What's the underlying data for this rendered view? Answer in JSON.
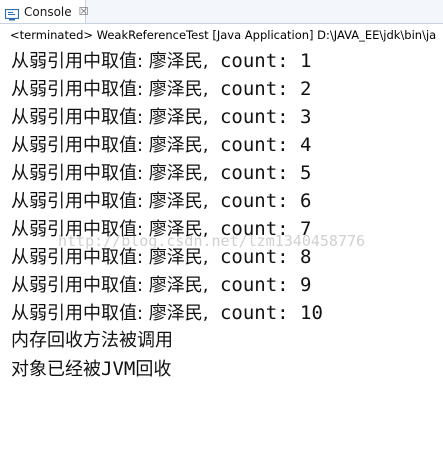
{
  "tab": {
    "label": "Console",
    "close_glyph": "☒",
    "icon": "console-monitor-icon"
  },
  "status_line": "<terminated> WeakReferenceTest [Java Application] D:\\JAVA_EE\\jdk\\bin\\ja",
  "output": {
    "lines": [
      {
        "prefix": "从弱引用中取值: 廖泽民,",
        "suffix": " count: 1"
      },
      {
        "prefix": "从弱引用中取值: 廖泽民,",
        "suffix": " count: 2"
      },
      {
        "prefix": "从弱引用中取值: 廖泽民,",
        "suffix": " count: 3"
      },
      {
        "prefix": "从弱引用中取值: 廖泽民,",
        "suffix": " count: 4"
      },
      {
        "prefix": "从弱引用中取值: 廖泽民,",
        "suffix": " count: 5"
      },
      {
        "prefix": "从弱引用中取值: 廖泽民,",
        "suffix": " count: 6"
      },
      {
        "prefix": "从弱引用中取值: 廖泽民,",
        "suffix": " count: 7"
      },
      {
        "prefix": "从弱引用中取值: 廖泽民,",
        "suffix": " count: 8"
      },
      {
        "prefix": "从弱引用中取值: 廖泽民,",
        "suffix": " count: 9"
      },
      {
        "prefix": "从弱引用中取值: 廖泽民,",
        "suffix": " count: 10"
      }
    ],
    "gc_called": "内存回收方法被调用",
    "recycled_pre": "对象已经被",
    "recycled_jvm": "JVM",
    "recycled_post": "回收"
  },
  "watermark": "http://blog.csdn.net/lzm1340458776",
  "colors": {
    "tab_bar_bg": "#f3f6fa",
    "text": "#111111",
    "icon_blue": "#2f6db5"
  }
}
